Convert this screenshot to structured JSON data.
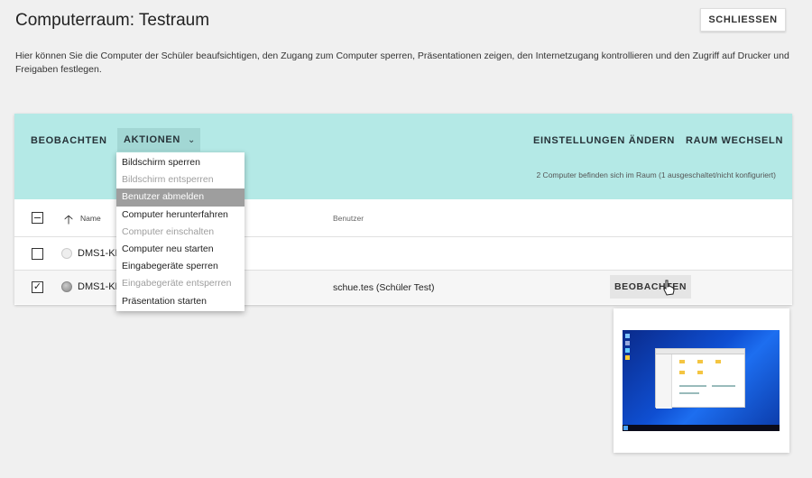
{
  "header": {
    "title": "Computerraum: Testraum",
    "close_label": "SCHLIESSEN",
    "description": "Hier können Sie die Computer der Schüler beaufsichtigen, den Zugang zum Computer sperren, Präsentationen zeigen, den Internetzugang kontrollieren und den Zugriff auf Drucker und Freigaben festlegen."
  },
  "toolbar": {
    "observe_label": "BEOBACHTEN",
    "actions_label": "AKTIONEN",
    "settings_label": "EINSTELLUNGEN ÄNDERN",
    "room_label": "RAUM WECHSELN",
    "room_info": "2 Computer befinden sich im Raum (1 ausgeschaltet/nicht konfiguriert)"
  },
  "table": {
    "col_name": "Name",
    "col_user": "Benutzer",
    "rows": [
      {
        "name": "DMS1-KD",
        "user": "",
        "selected": false,
        "status": "off"
      },
      {
        "name": "DMS1-KD",
        "user": "schue.tes (Schüler Test)",
        "selected": true,
        "status": "on",
        "observe_label": "BEOBACHTEN"
      }
    ]
  },
  "actions_menu": {
    "items": [
      {
        "label": "Bildschirm sperren",
        "state": "enabled"
      },
      {
        "label": "Bildschirm entsperren",
        "state": "disabled"
      },
      {
        "label": "Benutzer abmelden",
        "state": "active"
      },
      {
        "label": "Computer herunterfahren",
        "state": "enabled"
      },
      {
        "label": "Computer einschalten",
        "state": "disabled"
      },
      {
        "label": "Computer neu starten",
        "state": "enabled"
      },
      {
        "label": "Eingabegeräte sperren",
        "state": "enabled"
      },
      {
        "label": "Eingabegeräte entsperren",
        "state": "disabled"
      },
      {
        "label": "Präsentation starten",
        "state": "enabled"
      }
    ]
  },
  "colors": {
    "toolbar_bg": "#b4e9e6",
    "actions_bg": "#a2d7d4",
    "menu_active_bg": "#9e9e9e",
    "page_bg": "#f0f0f0"
  }
}
